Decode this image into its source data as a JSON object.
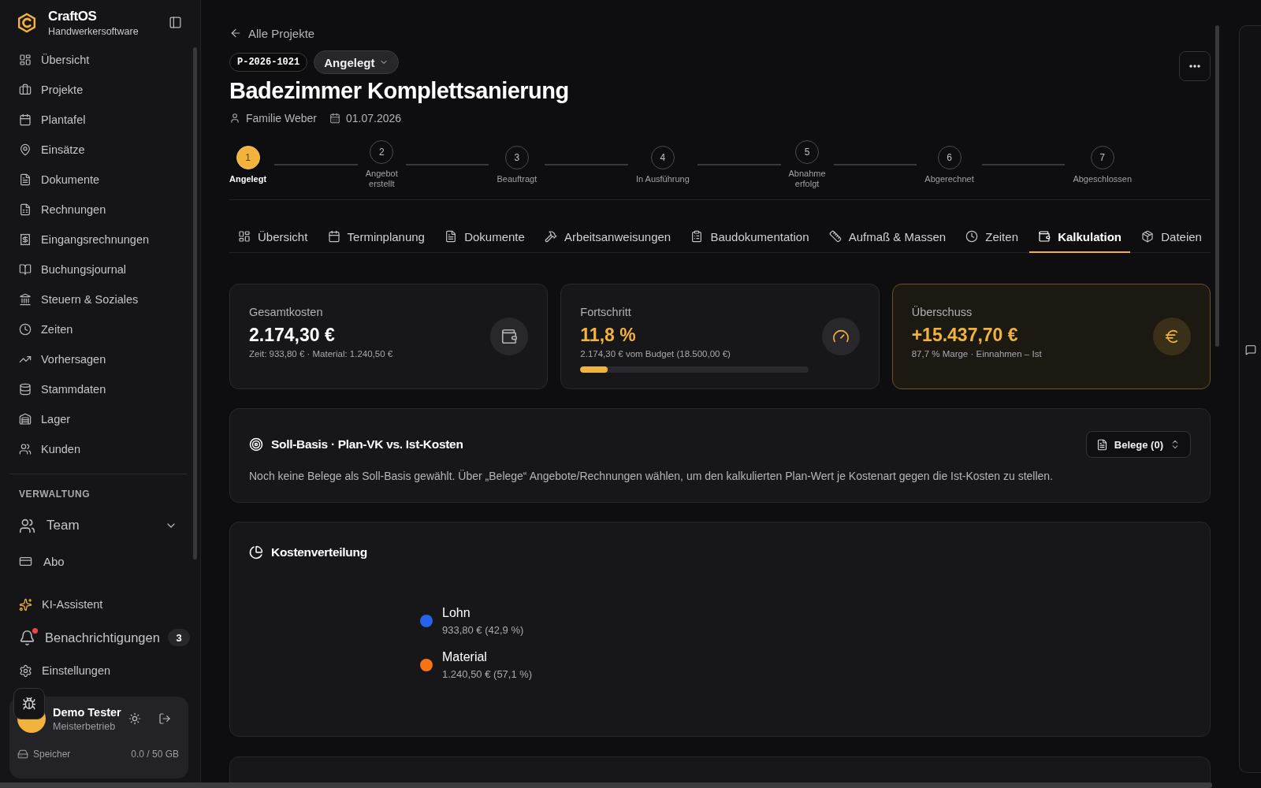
{
  "sidebar": {
    "brand": {
      "name": "CraftOS",
      "tagline": "Handwerkersoftware"
    },
    "nav": [
      {
        "label": "Übersicht"
      },
      {
        "label": "Projekte"
      },
      {
        "label": "Plantafel"
      },
      {
        "label": "Einsätze"
      },
      {
        "label": "Dokumente"
      },
      {
        "label": "Rechnungen"
      },
      {
        "label": "Eingangsrechnungen"
      },
      {
        "label": "Buchungsjournal"
      },
      {
        "label": "Steuern & Soziales"
      },
      {
        "label": "Zeiten"
      },
      {
        "label": "Vorhersagen"
      },
      {
        "label": "Stammdaten"
      },
      {
        "label": "Lager"
      },
      {
        "label": "Kunden"
      }
    ],
    "section": {
      "title": "VERWALTUNG",
      "items": [
        {
          "label": "Team",
          "kind": "group",
          "expanded": false
        },
        {
          "label": "Abo",
          "kind": "link"
        }
      ]
    },
    "utilities": [
      {
        "label": "KI-Assistent",
        "kind": "assistant"
      },
      {
        "label": "Benachrichtigungen",
        "kind": "notifications",
        "badge": "3",
        "unread": true
      },
      {
        "label": "Einstellungen",
        "kind": "settings"
      }
    ],
    "user": {
      "name": "Demo Tester",
      "role": "Meisterbetrieb"
    },
    "storage": {
      "label": "Speicher",
      "reading": "0.0 / 50 GB"
    }
  },
  "project": {
    "back_link": "Alle Projekte",
    "number": "P-2026-1021",
    "status": "Angelegt",
    "title": "Badezimmer Komplettsanierung",
    "customer": "Familie Weber",
    "date": "01.07.2026"
  },
  "steps": [
    {
      "number": "1",
      "label": "Angelegt",
      "active": true
    },
    {
      "number": "2",
      "label": "Angebot\nerstellt",
      "active": false
    },
    {
      "number": "3",
      "label": "Beauftragt",
      "active": false
    },
    {
      "number": "4",
      "label": "In Ausführung",
      "active": false
    },
    {
      "number": "5",
      "label": "Abnahme\nerfolgt",
      "active": false
    },
    {
      "number": "6",
      "label": "Abgerechnet",
      "active": false
    },
    {
      "number": "7",
      "label": "Abgeschlossen",
      "active": false
    }
  ],
  "tabs": [
    {
      "label": "Übersicht",
      "selected": false
    },
    {
      "label": "Terminplanung",
      "selected": false
    },
    {
      "label": "Dokumente",
      "selected": false
    },
    {
      "label": "Arbeitsanweisungen",
      "selected": false
    },
    {
      "label": "Baudokumentation",
      "selected": false
    },
    {
      "label": "Aufmaß & Massen",
      "selected": false
    },
    {
      "label": "Zeiten",
      "selected": false
    },
    {
      "label": "Kalkulation",
      "selected": true
    },
    {
      "label": "Dateien",
      "selected": false
    }
  ],
  "stats": [
    {
      "kind": "plain",
      "label": "Gesamtkosten",
      "value": "2.174,30 €",
      "detail": "Zeit: 933,80 € · Material: 1.240,50 €"
    },
    {
      "kind": "progress",
      "label": "Fortschritt",
      "value": "11,8 %",
      "detail": "2.174,30 € vom Budget (18.500,00 €)",
      "level": 0.118
    },
    {
      "kind": "highlight",
      "label": "Überschuss",
      "value": "+15.437,70 €",
      "detail": "87,7 % Marge · Einnahmen – Ist"
    }
  ],
  "target_basis": {
    "title": "Soll-Basis · Plan-VK vs. Ist-Kosten",
    "button": "Belege (0)",
    "description": "Noch keine Belege als Soll-Basis gewählt. Über „Belege“ Angebote/Rechnungen wählen, um den kalkulierten Plan-Wert je Kostenart gegen die Ist-Kosten zu stellen."
  },
  "cost_split": {
    "title": "Kostenverteilung",
    "legend": [
      {
        "label": "Lohn",
        "reading": "933,80 € (42,9 %)",
        "color": "#2563eb"
      },
      {
        "label": "Material",
        "reading": "1.240,50 € (57,1 %)",
        "color": "#f97316"
      }
    ]
  }
}
